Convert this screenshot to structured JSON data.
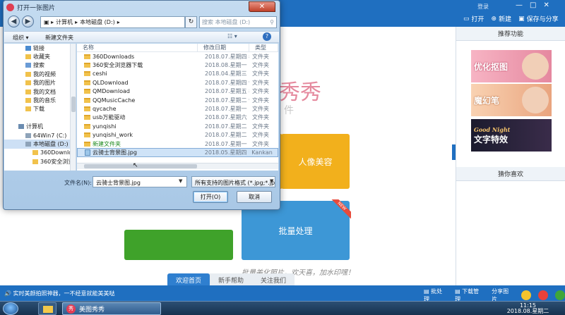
{
  "app": {
    "login": "登录",
    "window_controls": [
      "—",
      "□",
      "✕"
    ],
    "actions": {
      "open": "打开",
      "new": "新建",
      "save_share": "保存与分享"
    },
    "watermark_title": "秀秀",
    "watermark_sub": "件",
    "tiles": {
      "portrait": "人像美容",
      "batch": "批量处理",
      "new_badge": "NEW"
    },
    "handwriting": "批量美化照片，欢天喜，加水印嘿！",
    "bottom_tabs": [
      "欢迎首页",
      "新手帮助",
      "关注我们"
    ],
    "right_panel": {
      "title": "推荐功能",
      "promos": [
        "优化抠图",
        "魔幻笔",
        "文字特效"
      ],
      "promo3_sub": "Good Night",
      "guess": "猜你喜欢"
    },
    "status_left": "实时美颜拍照神器，一不经意就能美美哒",
    "status_right": {
      "batch": "批处理",
      "download": "下载管理",
      "share": "分享图片"
    }
  },
  "taskbar": {
    "meitu_label": "美图秀秀",
    "meitu_logo": "秀",
    "time": "11:15",
    "date": "2018.08.星期二"
  },
  "dialog": {
    "title": "打开一张图片",
    "close": "✕",
    "address": [
      "计算机",
      "本地磁盘 (D:)"
    ],
    "search_placeholder": "搜索 本地磁盘 (D:)",
    "toolbar": {
      "organize": "组织 ▾",
      "new_folder": "新建文件夹",
      "view": "☷ ▾",
      "help": "?"
    },
    "nav": [
      {
        "label": "链接",
        "type": "link"
      },
      {
        "label": "收藏夹",
        "type": "fav"
      },
      {
        "label": "搜索",
        "type": "search"
      },
      {
        "label": "我的视频",
        "type": "folder"
      },
      {
        "label": "我的图片",
        "type": "folder"
      },
      {
        "label": "我的文档",
        "type": "folder"
      },
      {
        "label": "我的音乐",
        "type": "folder"
      },
      {
        "label": "下载",
        "type": "folder"
      },
      {
        "label": "",
        "type": "gap"
      },
      {
        "label": "计算机",
        "type": "computer"
      },
      {
        "label": "64Win7 (C:)",
        "type": "drive"
      },
      {
        "label": "本地磁盘 (D:)",
        "type": "drive",
        "selected": true
      },
      {
        "label": "360Downlo",
        "type": "folder"
      },
      {
        "label": "360安全浏览",
        "type": "folder"
      }
    ],
    "columns": [
      "名称",
      "修改日期",
      "类型"
    ],
    "files": [
      {
        "name": "360Downloads",
        "date": "2018.07.星期四 8...",
        "type": "文件夹"
      },
      {
        "name": "360安全浏览器下载",
        "date": "2018.08.星期一 1...",
        "type": "文件夹"
      },
      {
        "name": "ceshi",
        "date": "2018.04.星期三 1...",
        "type": "文件夹"
      },
      {
        "name": "QLDownload",
        "date": "2018.07.星期四 9...",
        "type": "文件夹"
      },
      {
        "name": "QMDownload",
        "date": "2018.07.星期五 8...",
        "type": "文件夹"
      },
      {
        "name": "QQMusicCache",
        "date": "2018.07.星期二 9...",
        "type": "文件夹"
      },
      {
        "name": "qycache",
        "date": "2018.07.星期一 1...",
        "type": "文件夹"
      },
      {
        "name": "usb万能驱动",
        "date": "2018.07.星期六 1...",
        "type": "文件夹"
      },
      {
        "name": "yunqishi",
        "date": "2018.07.星期二 1...",
        "type": "文件夹"
      },
      {
        "name": "yunqishi_work",
        "date": "2018.07.星期二 1...",
        "type": "文件夹"
      },
      {
        "name": "新建文件夹",
        "date": "2018.07.星期一 1...",
        "type": "文件夹",
        "green": true
      },
      {
        "name": "云骑士背景图.jpg",
        "date": "2018.05.星期四 1...",
        "type": "Kankan",
        "file": true,
        "selected": true
      }
    ],
    "filename_label": "文件名(N):",
    "filename_value": "云骑士背景图.jpg",
    "filetype_value": "所有支持的图片格式 (*.jpg;*.jp",
    "open_btn": "打开(O)",
    "cancel_btn": "取消"
  },
  "colors": {
    "app_blue": "#1f6fc0",
    "tile_orange": "#f2b01c",
    "tile_blue": "#3d97d6",
    "tile_green": "#3fa22a"
  }
}
